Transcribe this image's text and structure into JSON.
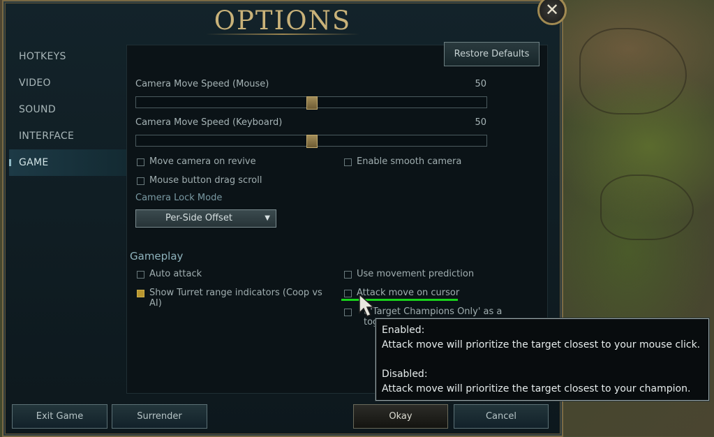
{
  "window": {
    "title": "OPTIONS",
    "close_glyph": "✕"
  },
  "nav": {
    "items": [
      {
        "label": "HOTKEYS"
      },
      {
        "label": "VIDEO"
      },
      {
        "label": "SOUND"
      },
      {
        "label": "INTERFACE"
      },
      {
        "label": "GAME",
        "active": true
      }
    ]
  },
  "toolbar": {
    "restore_label": "Restore Defaults"
  },
  "camera": {
    "mouse_speed_label": "Camera Move Speed (Mouse)",
    "mouse_speed_value": "50",
    "keyboard_speed_label": "Camera Move Speed (Keyboard)",
    "keyboard_speed_value": "50",
    "move_on_revive": "Move camera on revive",
    "smooth_camera": "Enable smooth camera",
    "drag_scroll": "Mouse button drag scroll",
    "lock_mode_label": "Camera Lock Mode",
    "lock_mode_value": "Per-Side Offset"
  },
  "gameplay": {
    "heading": "Gameplay",
    "auto_attack": "Auto attack",
    "turret_range": "Show Turret range indicators (Coop vs",
    "turret_range_cont": "AI)",
    "movement_prediction": "Use movement prediction",
    "attack_move_cursor": "Attack move on cursor",
    "target_champ_partial_a": "t 'Target Champions Only' as a",
    "target_champ_partial_b": "togg"
  },
  "tooltip": {
    "enabled_title": "Enabled:",
    "enabled_text": "Attack move will prioritize the target closest to your mouse click.",
    "disabled_title": "Disabled:",
    "disabled_text": "Attack move will prioritize the target closest to your champion."
  },
  "buttons": {
    "exit": "Exit Game",
    "surrender": "Surrender",
    "okay": "Okay",
    "cancel": "Cancel"
  },
  "colors": {
    "accent_gold": "#c9b279",
    "highlight_green": "#18d21a",
    "checked": "#b8962f"
  }
}
